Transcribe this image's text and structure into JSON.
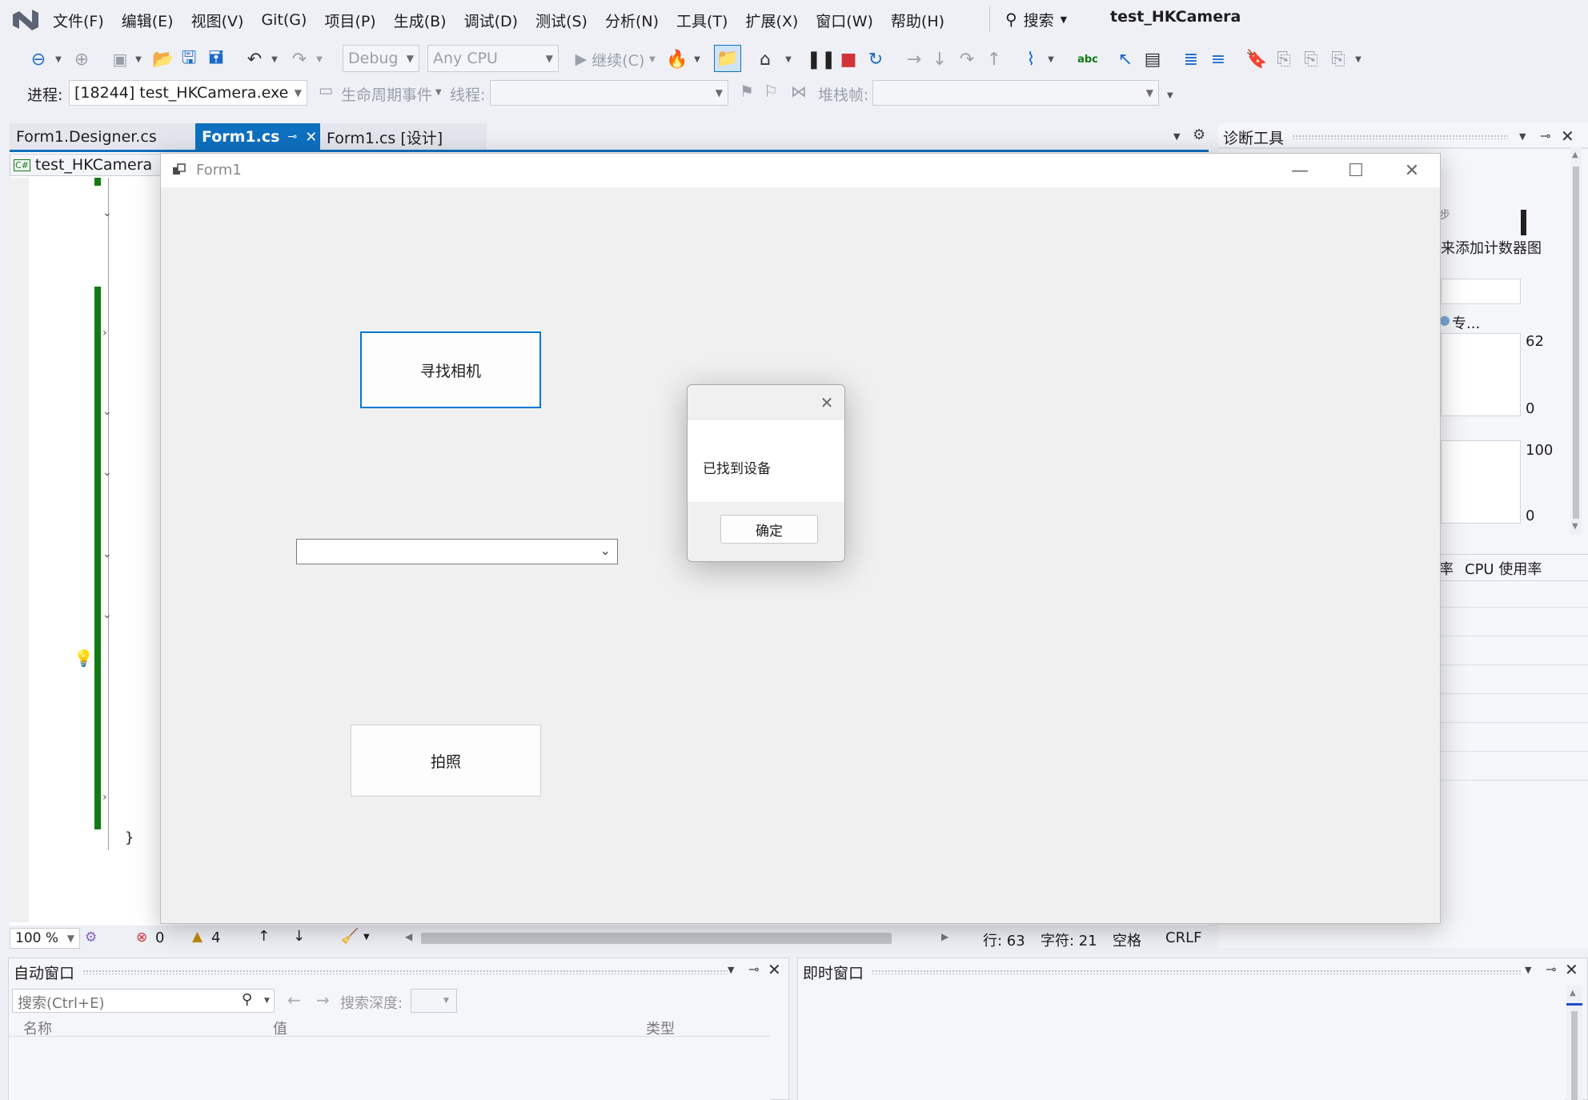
{
  "menu": {
    "items": [
      "文件(F)",
      "编辑(E)",
      "视图(V)",
      "Git(G)",
      "项目(P)",
      "生成(B)",
      "调试(D)",
      "测试(S)",
      "分析(N)",
      "工具(T)",
      "扩展(X)",
      "窗口(W)",
      "帮助(H)"
    ],
    "search_label": "搜索",
    "solution_title": "test_HKCamera"
  },
  "toolbar": {
    "config": "Debug",
    "platform": "Any CPU",
    "continue_label": "继续(C)"
  },
  "process_bar": {
    "process_label": "进程:",
    "process_value": "[18244] test_HKCamera.exe",
    "lifecycle_label": "生命周期事件",
    "thread_label": "线程:",
    "stackframe_label": "堆栈帧:"
  },
  "tabs": [
    {
      "label": "Form1.Designer.cs"
    },
    {
      "label": "Form1.cs"
    },
    {
      "label": "Form1.cs [设计]"
    }
  ],
  "editor": {
    "nav_project": "test_HKCamera",
    "closing_brace": "}"
  },
  "diag": {
    "title": "诊断工具",
    "counter_hint": "来添加计数器图",
    "item_label": "专...",
    "axis1_max": "62",
    "axis1_min": "0",
    "axis2_max": "100",
    "axis2_min": "0",
    "tab_partial": "率",
    "tab_cpu": "CPU 使用率",
    "sync_partial": "步"
  },
  "form1": {
    "title": "Form1",
    "find_camera_label": "寻找相机",
    "photo_label": "拍照",
    "camera_combo_value": ""
  },
  "msgbox": {
    "message": "已找到设备",
    "ok_label": "确定"
  },
  "statusbar": {
    "zoom": "100 %",
    "errors": "0",
    "warnings": "4",
    "line": "行: 63",
    "char": "字符: 21",
    "spaces": "空格",
    "eol": "CRLF"
  },
  "autos": {
    "title": "自动窗口",
    "search_placeholder": "搜索(Ctrl+E)",
    "depth_label": "搜索深度:",
    "col_name": "名称",
    "col_value": "值",
    "col_type": "类型"
  },
  "immediate": {
    "title": "即时窗口"
  }
}
